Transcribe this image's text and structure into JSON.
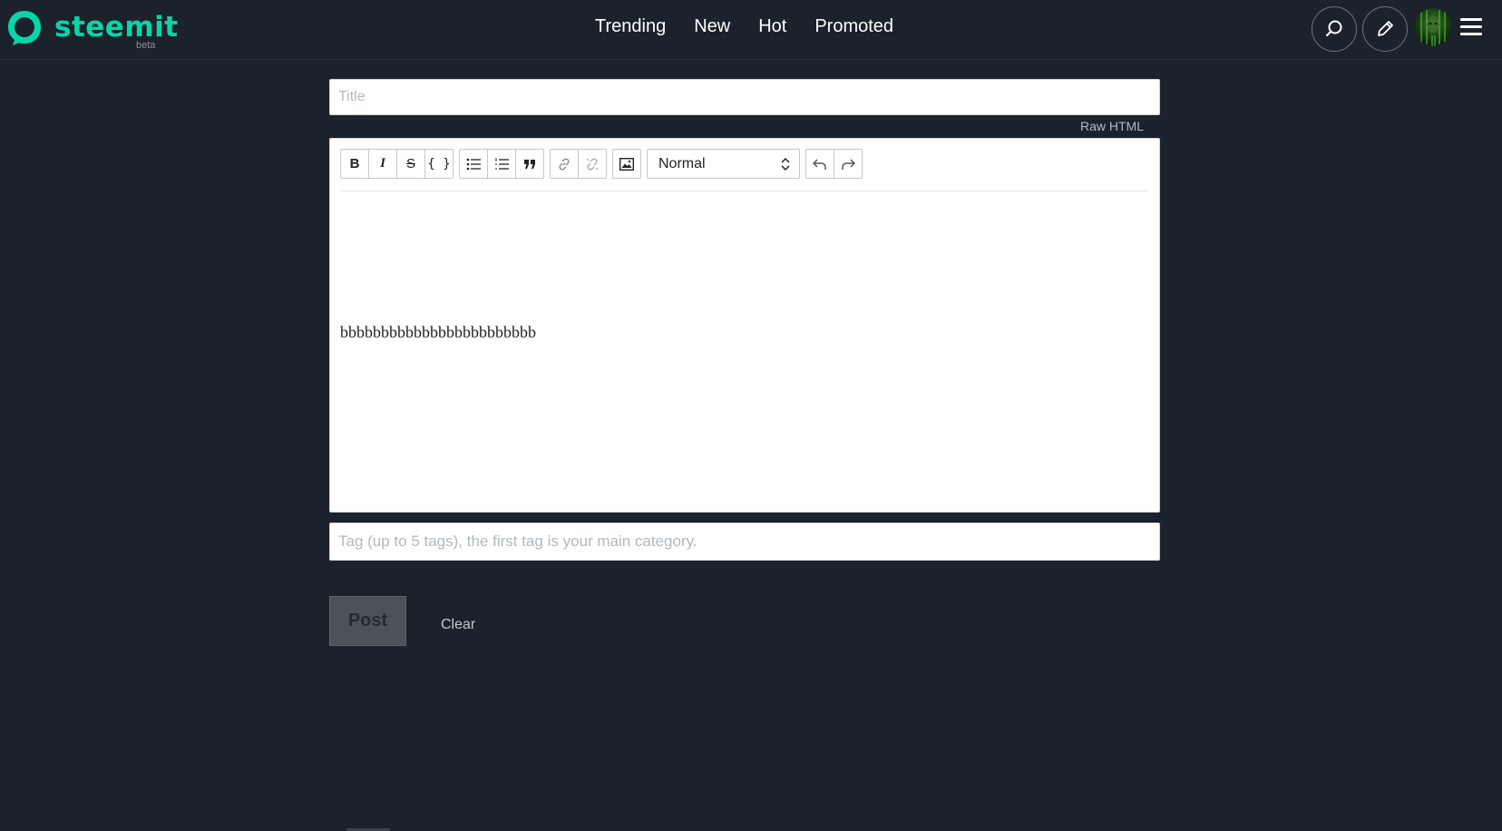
{
  "header": {
    "logo_text": "steemit",
    "logo_subtitle": "beta",
    "nav": [
      "Trending",
      "New",
      "Hot",
      "Promoted"
    ],
    "search_icon": "search-icon",
    "compose_icon": "pencil-icon",
    "menu_icon": "hamburger-icon"
  },
  "editor": {
    "title_placeholder": "Title",
    "title_value": "",
    "raw_html_label": "Raw HTML",
    "toolbar": {
      "bold": "B",
      "italic": "I",
      "strike": "S",
      "code": "{ }",
      "format_select": "Normal"
    },
    "body_text": "bbbbbbbbbbbbbbbbbbbbbbbb",
    "tag_placeholder": "Tag (up to 5 tags), the first tag is your main category.",
    "tag_value": ""
  },
  "actions": {
    "post_label": "Post",
    "clear_label": "Clear"
  },
  "colors": {
    "background": "#1c222b",
    "brand": "#06d6a9"
  }
}
